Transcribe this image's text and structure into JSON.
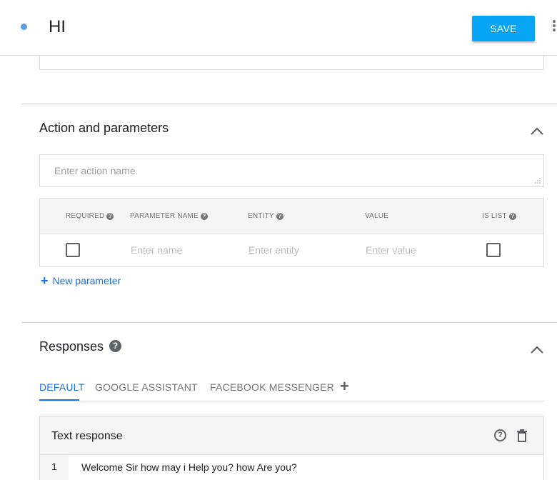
{
  "header": {
    "title": "HI",
    "save_label": "SAVE"
  },
  "action_section": {
    "title": "Action and parameters",
    "action_placeholder": "Enter action name",
    "table": {
      "columns": [
        "REQUIRED",
        "PARAMETER NAME",
        "ENTITY",
        "VALUE",
        "IS LIST"
      ],
      "row": {
        "name_placeholder": "Enter name",
        "entity_placeholder": "Enter entity",
        "value_placeholder": "Enter value"
      }
    },
    "new_parameter_label": "New parameter"
  },
  "responses_section": {
    "title": "Responses",
    "tabs": [
      "DEFAULT",
      "GOOGLE ASSISTANT",
      "FACEBOOK MESSENGER"
    ],
    "text_response": {
      "title": "Text response",
      "rows": [
        {
          "num": "1",
          "text": "Welcome Sir how may i Help you? how Are you?"
        }
      ]
    }
  },
  "colors": {
    "accent": "#1a73e8",
    "save_button": "#06a4f4",
    "status_dot": "#5b9ee8"
  }
}
